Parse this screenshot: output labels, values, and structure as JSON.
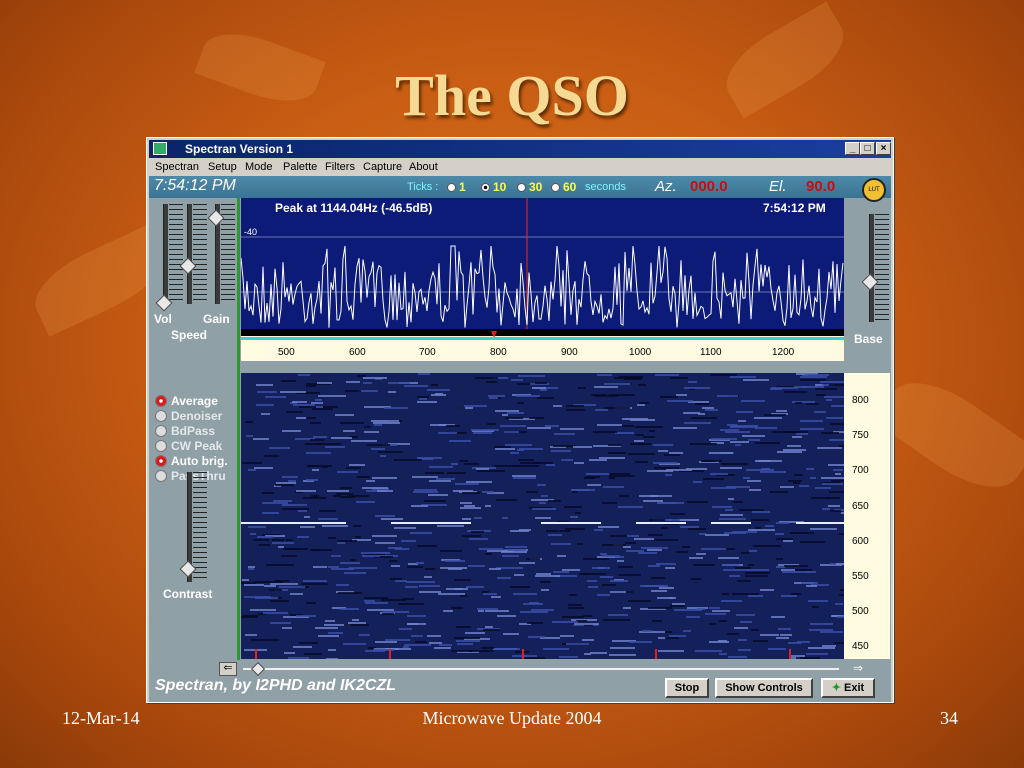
{
  "slide": {
    "title": "The QSO",
    "footer_date": "12-Mar-14",
    "footer_center": "Microwave Update 2004",
    "page_number": "34"
  },
  "window": {
    "title": "Spectran Version 1",
    "minimize": "_",
    "maximize": "□",
    "close": "×"
  },
  "menu": [
    "Spectran",
    "Setup",
    "Mode",
    "Palette",
    "Filters",
    "Capture",
    "About"
  ],
  "topbar": {
    "time": "7:54:12 PM",
    "ticks_label": "Ticks :",
    "tick_options": [
      "1",
      "10",
      "30",
      "60"
    ],
    "selected_tick": "10",
    "seconds_label": "seconds",
    "az_label": "Az.",
    "az_value": "000.0",
    "el_label": "El.",
    "el_value": "90.0",
    "lut_icon": "LUT"
  },
  "left_panel": {
    "vol_label": "Vol",
    "gain_label": "Gain",
    "speed_label": "Speed",
    "contrast_label": "Contrast",
    "options": [
      {
        "label": "Average",
        "on": true
      },
      {
        "label": "Denoiser",
        "on": false
      },
      {
        "label": "BdPass",
        "on": false
      },
      {
        "label": "CW Peak",
        "on": false
      },
      {
        "label": "Auto brig.",
        "on": true
      },
      {
        "label": "PassThru",
        "on": false
      }
    ]
  },
  "right_panel": {
    "base_label": "Base"
  },
  "spectrum": {
    "peak_text": "Peak at  1144.04Hz (-46.5dB)",
    "time": "7:54:12 PM",
    "y_label": "-40",
    "freq_ticks": [
      "500",
      "600",
      "700",
      "800",
      "900",
      "1000",
      "1100",
      "1200"
    ]
  },
  "waterfall": {
    "y_ticks": [
      "800",
      "750",
      "700",
      "650",
      "600",
      "550",
      "500",
      "450"
    ]
  },
  "bottom": {
    "app_credit": "Spectran, by I2PHD and IK2CZL",
    "stop": "Stop",
    "show_controls": "Show Controls",
    "exit": "Exit"
  },
  "colors": {
    "accent_red": "#c31010",
    "spectrum_bg": "#0c1a78",
    "waterfall_bg": "#14205a"
  }
}
